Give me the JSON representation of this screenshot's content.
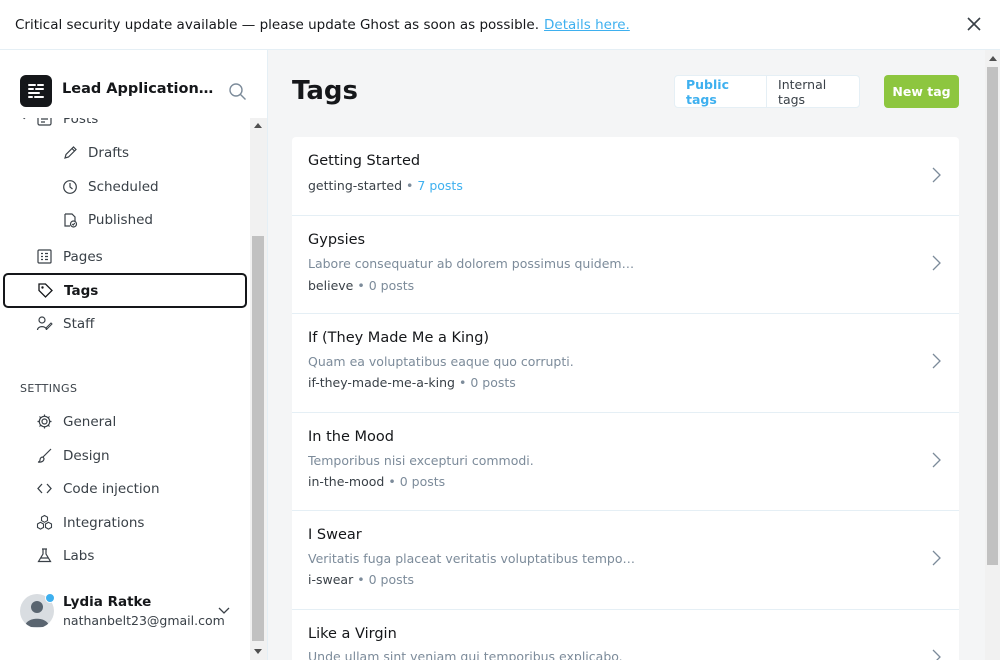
{
  "banner": {
    "message": "Critical security update available — please update Ghost as soon as possible.",
    "link": "Details here."
  },
  "sidebar": {
    "site_title": "Lead Applications for Developers",
    "nav": [
      {
        "label": "Posts",
        "icon": "posts-icon"
      },
      {
        "label": "Drafts",
        "icon": "pencil-icon"
      },
      {
        "label": "Scheduled",
        "icon": "clock-icon"
      },
      {
        "label": "Published",
        "icon": "published-icon"
      },
      {
        "label": "Pages",
        "icon": "pages-icon"
      },
      {
        "label": "Tags",
        "icon": "tag-icon",
        "active": true
      },
      {
        "label": "Staff",
        "icon": "staff-icon"
      }
    ],
    "settings_title": "SETTINGS",
    "settings": [
      {
        "label": "General",
        "icon": "gear-icon"
      },
      {
        "label": "Design",
        "icon": "brush-icon"
      },
      {
        "label": "Code injection",
        "icon": "code-icon"
      },
      {
        "label": "Integrations",
        "icon": "integrations-icon"
      },
      {
        "label": "Labs",
        "icon": "flask-icon"
      }
    ],
    "user": {
      "name": "Lydia Ratke",
      "email": "nathanbelt23@gmail.com"
    }
  },
  "main": {
    "title": "Tags",
    "filter_public": "Public tags",
    "filter_internal": "Internal tags",
    "new_button": "New tag",
    "tags": [
      {
        "name": "Getting Started",
        "description": "",
        "slug": "getting-started",
        "count": "7 posts"
      },
      {
        "name": "Gypsies",
        "description": "Labore consequatur ab dolorem possimus quidem doloribus.",
        "slug": "believe",
        "count": "0 posts"
      },
      {
        "name": "If (They Made Me a King)",
        "description": "Quam ea voluptatibus eaque quo corrupti.",
        "slug": "if-they-made-me-a-king",
        "count": "0 posts"
      },
      {
        "name": "In the Mood",
        "description": "Temporibus nisi excepturi commodi.",
        "slug": "in-the-mood",
        "count": "0 posts"
      },
      {
        "name": "I Swear",
        "description": "Veritatis fuga placeat veritatis voluptatibus tempore quas.",
        "slug": "i-swear",
        "count": "0 posts"
      },
      {
        "name": "Like a Virgin",
        "description": "Unde ullam sint veniam qui temporibus explicabo.",
        "slug": "",
        "count": ""
      }
    ]
  },
  "colors": {
    "accent": "#3eb0ef",
    "primary_button": "#8dc63f",
    "text": "#15171a"
  }
}
